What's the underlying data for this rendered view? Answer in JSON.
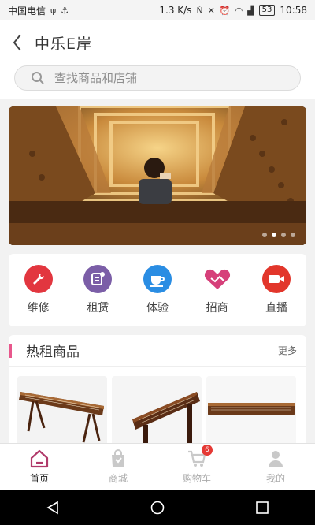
{
  "status_bar": {
    "carrier": "中国电信",
    "speed": "1.3 K/s",
    "battery": "53",
    "time": "10:58"
  },
  "header": {
    "title": "中乐E岸"
  },
  "search": {
    "placeholder": "查找商品和店铺"
  },
  "banner": {
    "slide_count": 4,
    "active_index": 1
  },
  "categories": [
    {
      "label": "维修",
      "icon": "wrench-icon",
      "color": "#e2363f"
    },
    {
      "label": "租赁",
      "icon": "rent-icon",
      "color": "#7b5ea7"
    },
    {
      "label": "体验",
      "icon": "coffee-icon",
      "color": "#2a8de3"
    },
    {
      "label": "招商",
      "icon": "handshake-icon",
      "color": "#d6407a"
    },
    {
      "label": "直播",
      "icon": "video-camera-icon",
      "color": "#e2362b"
    }
  ],
  "hot_section": {
    "title": "热租商品",
    "more": "更多"
  },
  "tabbar": {
    "items": [
      {
        "label": "首页",
        "icon": "home-icon",
        "active": true
      },
      {
        "label": "商城",
        "icon": "shopping-bag-icon",
        "active": false
      },
      {
        "label": "购物车",
        "icon": "cart-icon",
        "active": false,
        "badge": "6"
      },
      {
        "label": "我的",
        "icon": "user-icon",
        "active": false
      }
    ]
  },
  "colors": {
    "accent": "#e8578c",
    "tab_active": "#b03a6a",
    "tab_inactive": "#c9c9c9"
  }
}
